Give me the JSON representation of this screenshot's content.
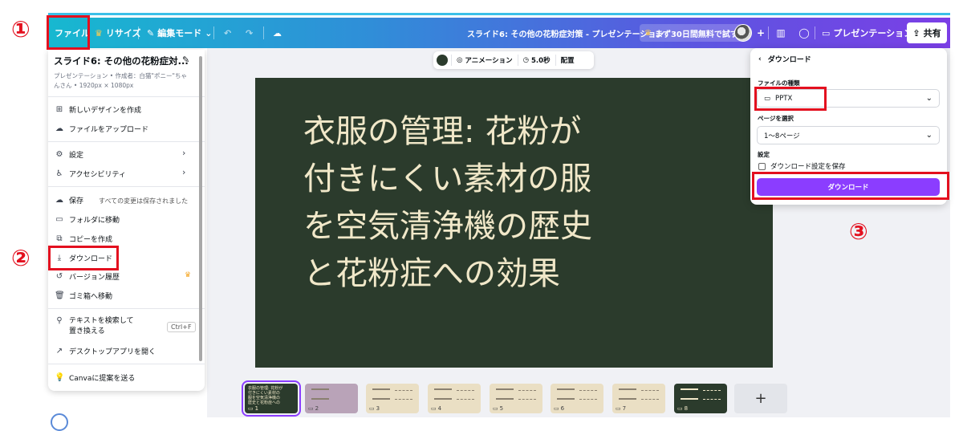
{
  "toolbar": {
    "file": "ファイル",
    "resize": "リサイズ",
    "edit_mode": "編集モード",
    "doc_title": "スライド6: その他の花粉症対策 - プレゼンテーション",
    "trial": "まず30日間無料で試す",
    "present": "プレゼンテーション",
    "share": "共有"
  },
  "file_panel": {
    "title": "スライド6: その他の花粉症対...",
    "meta": "プレゼンテーション • 作成者：白猫\"ポニー\"ちゃんさん • 1920px × 1080px",
    "items": {
      "new_design": "新しいデザインを作成",
      "upload": "ファイルをアップロード",
      "settings": "設定",
      "accessibility": "アクセシビリティ",
      "save": "保存",
      "save_status": "すべての変更は保存されました",
      "move_folder": "フォルダに移動",
      "copy": "コピーを作成",
      "download": "ダウンロード",
      "version_history": "バージョン履歴",
      "trash": "ゴミ箱へ移動",
      "find_replace": "テキストを検索して置き換える",
      "find_shortcut": "Ctrl+F",
      "desktop_app": "デスクトップアプリを開く",
      "feedback": "Canvaに提案を送る"
    }
  },
  "context_bar": {
    "animation": "アニメーション",
    "duration": "5.0秒",
    "position": "配置"
  },
  "slide": {
    "text": "衣服の管理: 花粉が付きにくい素材の服を空気清浄機の歴史と花粉症への効果",
    "bg_color": "#2b3b2c",
    "text_color": "#f1e8c9"
  },
  "download_panel": {
    "title": "ダウンロード",
    "file_type_label": "ファイルの種類",
    "file_type": "PPTX",
    "pages_label": "ページを選択",
    "pages": "1〜8ページ",
    "settings_label": "設定",
    "save_settings": "ダウンロード設定を保存",
    "button": "ダウンロード"
  },
  "thumbnails": {
    "numbers": [
      "1",
      "2",
      "3",
      "4",
      "5",
      "6",
      "7",
      "8"
    ],
    "t1_text": "衣服の管理: 花粉が付きにくい素材の服を空気清浄機の歴史と花粉症への",
    "add": "+"
  },
  "annotations": {
    "step1": "①",
    "step2": "②",
    "step3": "③",
    "highlight_color": "#e3101f"
  },
  "colors": {
    "accent": "#8b3dff",
    "toolbar_start": "#17b8d0",
    "toolbar_end": "#7b3ee6"
  }
}
